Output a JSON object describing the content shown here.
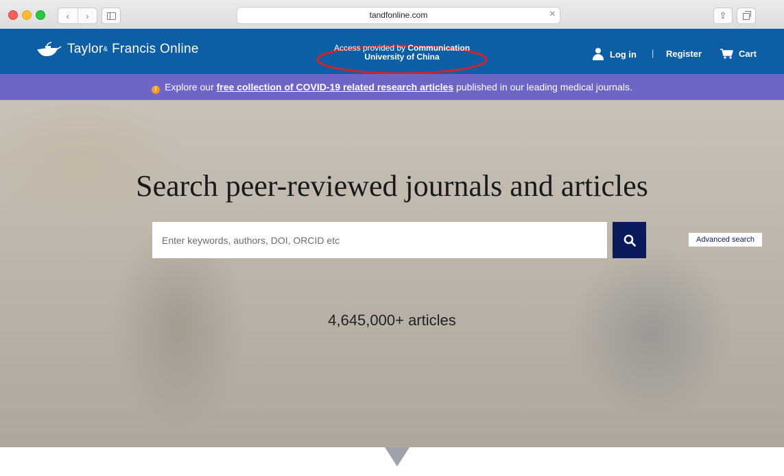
{
  "browser": {
    "url": "tandfonline.com",
    "back_glyph": "‹",
    "forward_glyph": "›",
    "close_glyph": "×",
    "share_glyph": "⇪"
  },
  "header": {
    "brand": "Taylor",
    "brand_amp": "&",
    "brand_rest": "Francis Online",
    "access_line1": "Access provided by",
    "access_line1_bold": "Communication",
    "access_line2": "University of China",
    "login_label": "Log in",
    "divider": "|",
    "register_label": "Register",
    "cart_label": "Cart"
  },
  "banner": {
    "icon": "!",
    "prefix": "Explore our",
    "link_text": "free collection of COVID-19 related research articles",
    "suffix": "published in our leading medical journals."
  },
  "hero": {
    "title": "Search peer-reviewed journals and articles",
    "search_placeholder": "Enter keywords, authors, DOI, ORCID etc",
    "advanced_search_label": "Advanced search",
    "article_count": "4,645,000+ articles"
  },
  "colors": {
    "header_blue": "#0e5ea6",
    "banner_purple": "#6d66c7",
    "search_button_navy": "#0a1a5c",
    "access_highlight_ring": "#d2232a"
  },
  "icons": {
    "logo": "teapot-lamp-icon",
    "login": "user-icon",
    "cart": "cart-icon",
    "search": "search-icon",
    "banner": "warning-icon",
    "scroll": "chevron-down-icon"
  }
}
